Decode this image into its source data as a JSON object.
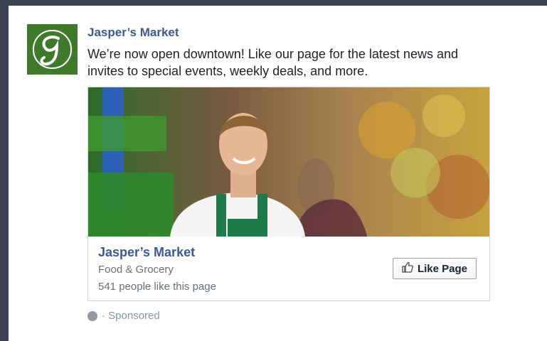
{
  "post": {
    "page_name": "Jasper’s Market",
    "text": "We’re now open downtown! Like our page for the latest news and invites to special events, weekly deals, and more.",
    "sponsored": "· Sponsored"
  },
  "ad": {
    "page_name": "Jasper’s Market",
    "category": "Food & Grocery",
    "likes": "541 people like this page",
    "like_button_label": "Like Page"
  },
  "logo": {
    "letter": "g"
  },
  "colors": {
    "brand_blue": "#3b5998",
    "logo_green": "#3f7a2a",
    "background": "#3b4150"
  },
  "icons": {
    "logo": "jaspers-market-logo-icon",
    "like": "thumbs-up-icon",
    "audience": "globe-icon"
  }
}
